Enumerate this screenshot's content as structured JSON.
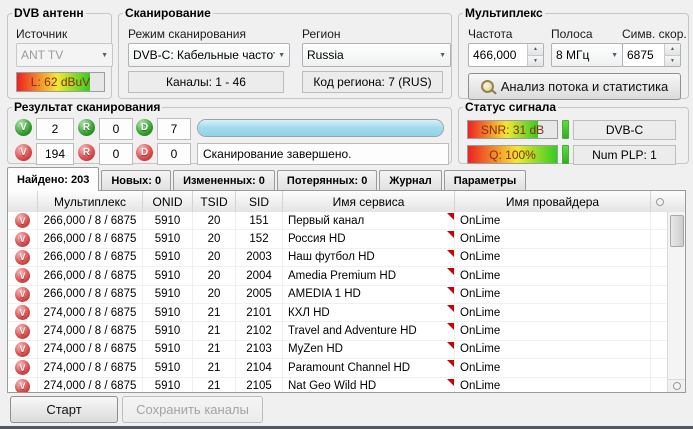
{
  "groups": {
    "antenna": {
      "title": "DVB антенн",
      "source_label": "Источник",
      "source_value": "ANT TV",
      "level_text": "L: 62 dBuV",
      "level_percent": 84
    },
    "scanning": {
      "title": "Сканирование",
      "mode_label": "Режим сканирования",
      "mode_value": "DVB-C: Кабельные частоты",
      "region_label": "Регион",
      "region_value": "Russia",
      "channels_text": "Каналы: 1 - 46",
      "region_code_text": "Код региона: 7 (RUS)"
    },
    "multiplex": {
      "title": "Мультиплекс",
      "freq_label": "Частота",
      "freq_value": "466,000",
      "band_label": "Полоса",
      "band_value": "8 МГц",
      "symrate_label": "Симв. скор.",
      "symrate_value": "6875",
      "analyze_button": "Анализ потока и статистика"
    },
    "scan_result": {
      "title": "Результат сканирования",
      "counters_ok": [
        {
          "letter": "V",
          "value": "2"
        },
        {
          "letter": "R",
          "value": "0"
        },
        {
          "letter": "D",
          "value": "7"
        }
      ],
      "counters_bad": [
        {
          "letter": "V",
          "value": "194"
        },
        {
          "letter": "R",
          "value": "0"
        },
        {
          "letter": "D",
          "value": "0"
        }
      ],
      "progress_percent": 100,
      "status_text": "Сканирование завершено."
    },
    "signal_status": {
      "title": "Статус сигнала",
      "snr_text": "SNR: 31 dB",
      "snr_percent": 79,
      "q_text": "Q: 100%",
      "q_percent": 100,
      "standard": "DVB-C",
      "num_plp": "Num PLP: 1"
    }
  },
  "tabs": [
    {
      "label": "Найдено: 203",
      "active": true
    },
    {
      "label": "Новых: 0",
      "active": false
    },
    {
      "label": "Измененных: 0",
      "active": false
    },
    {
      "label": "Потерянных: 0",
      "active": false
    },
    {
      "label": "Журнал",
      "active": false
    },
    {
      "label": "Параметры",
      "active": false
    }
  ],
  "table": {
    "headers": [
      "",
      "Мультиплекс",
      "ONID",
      "TSID",
      "SID",
      "Имя сервиса",
      "Имя провайдера"
    ],
    "row_icon_letter": "V",
    "rows": [
      [
        "266,000 / 8 / 6875",
        "5910",
        "20",
        "151",
        "Первый канал",
        "OnLime"
      ],
      [
        "266,000 / 8 / 6875",
        "5910",
        "20",
        "152",
        "Россия HD",
        "OnLime"
      ],
      [
        "266,000 / 8 / 6875",
        "5910",
        "20",
        "2003",
        "Наш футбол HD",
        "OnLime"
      ],
      [
        "266,000 / 8 / 6875",
        "5910",
        "20",
        "2004",
        "Amedia Premium HD",
        "OnLime"
      ],
      [
        "266,000 / 8 / 6875",
        "5910",
        "20",
        "2005",
        "AMEDIA 1 HD",
        "OnLime"
      ],
      [
        "274,000 / 8 / 6875",
        "5910",
        "21",
        "2101",
        "КХЛ HD",
        "OnLime"
      ],
      [
        "274,000 / 8 / 6875",
        "5910",
        "21",
        "2102",
        "Travel and Adventure HD",
        "OnLime"
      ],
      [
        "274,000 / 8 / 6875",
        "5910",
        "21",
        "2103",
        "MyZen HD",
        "OnLime"
      ],
      [
        "274,000 / 8 / 6875",
        "5910",
        "21",
        "2104",
        "Paramount Channel HD",
        "OnLime"
      ],
      [
        "274,000 / 8 / 6875",
        "5910",
        "21",
        "2105",
        "Nat Geo Wild HD",
        "OnLime"
      ]
    ]
  },
  "footer": {
    "start_button": "Старт",
    "save_button": "Сохранить каналы"
  },
  "colors": {
    "window_bg": "#f0f0f0",
    "progress_blue": "#a5dcee",
    "ok_green": "#3aa432",
    "error_red": "#dd5050",
    "marker_red": "#cc0000",
    "bar_text": "#8c2a14"
  }
}
